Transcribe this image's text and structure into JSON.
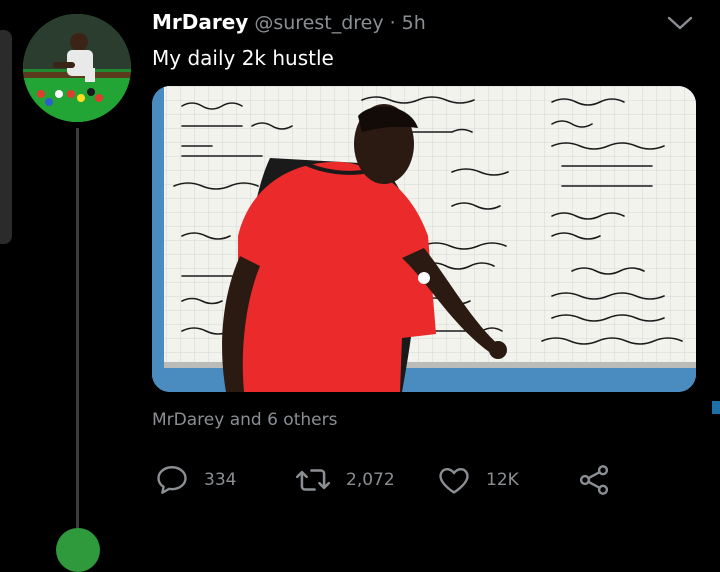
{
  "tweet": {
    "display_name": "MrDarey",
    "handle": "@surest_drey",
    "separator": "·",
    "time": "5h",
    "text": "My daily 2k hustle",
    "liked_by": "MrDarey and 6 others"
  },
  "actions": {
    "reply_count": "334",
    "retweet_count": "2,072",
    "like_count": "12K"
  },
  "icons": {
    "reply": "reply-icon",
    "retweet": "retweet-icon",
    "like": "heart-icon",
    "share": "share-icon",
    "more": "chevron-down-icon"
  },
  "colors": {
    "background": "#000000",
    "muted_text": "#8b8f93",
    "accent_blue": "#1d6fa8"
  }
}
